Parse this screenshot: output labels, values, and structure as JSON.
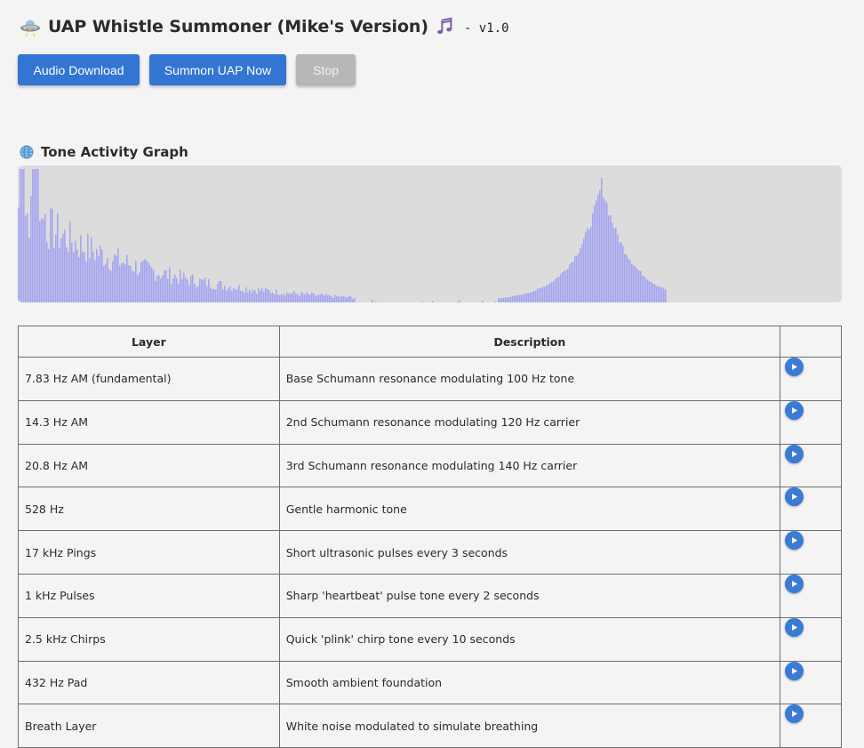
{
  "header": {
    "title": "UAP Whistle Summoner (Mike's Version)",
    "version": "- v1.0",
    "title_icon": "ufo-icon",
    "music_icon": "music-notes-icon"
  },
  "buttons": {
    "download": "Audio Download",
    "summon": "Summon UAP Now",
    "stop": "Stop"
  },
  "graph": {
    "title": "Tone Activity Graph",
    "icon": "globe-icon",
    "bar_color": "#a6a6ef",
    "background": "#dcdcdc"
  },
  "table": {
    "headers": {
      "layer": "Layer",
      "description": "Description",
      "action": ""
    },
    "rows": [
      {
        "layer": "7.83 Hz AM (fundamental)",
        "description": "Base Schumann resonance modulating 100 Hz tone"
      },
      {
        "layer": "14.3 Hz AM",
        "description": "2nd Schumann resonance modulating 120 Hz carrier"
      },
      {
        "layer": "20.8 Hz AM",
        "description": "3rd Schumann resonance modulating 140 Hz carrier"
      },
      {
        "layer": "528 Hz",
        "description": "Gentle harmonic tone"
      },
      {
        "layer": "17 kHz Pings",
        "description": "Short ultrasonic pulses every 3 seconds"
      },
      {
        "layer": "1 kHz Pulses",
        "description": "Sharp 'heartbeat' pulse tone every 2 seconds"
      },
      {
        "layer": "2.5 kHz Chirps",
        "description": "Quick 'plink' chirp tone every 10 seconds"
      },
      {
        "layer": "432 Hz Pad",
        "description": "Smooth ambient foundation"
      },
      {
        "layer": "Breath Layer",
        "description": "White noise modulated to simulate breathing"
      }
    ],
    "play_icon": "play-icon",
    "accent": "#3a7bd5"
  }
}
